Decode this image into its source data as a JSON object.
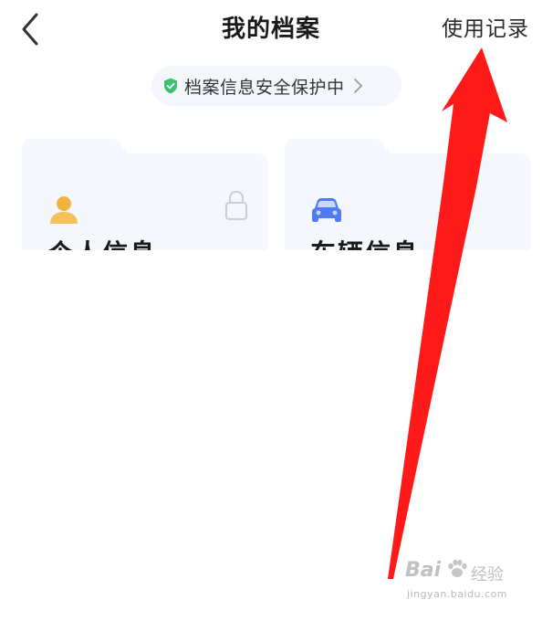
{
  "header": {
    "back_icon": "chevron-left-icon",
    "title": "我的档案",
    "right_action": "使用记录"
  },
  "security_banner": {
    "icon": "shield-check-icon",
    "text": "档案信息安全保护中",
    "chevron": "chevron-right-icon",
    "icon_color": "#3fbf6f"
  },
  "cards": [
    {
      "title": "个人信息",
      "icon": "person-icon",
      "icon_color": "#f2b440",
      "locked": true,
      "lock_icon": "lock-icon"
    },
    {
      "title": "车辆信息",
      "icon": "car-icon",
      "icon_color": "#4f7cf0",
      "locked": false
    }
  ],
  "annotation": {
    "type": "red-arrow",
    "color": "#ff1a1a",
    "points_to": "使用记录"
  },
  "watermark": {
    "brand": "Bai",
    "brand_suffix": "经验",
    "url": "jingyan.baidu.com"
  }
}
